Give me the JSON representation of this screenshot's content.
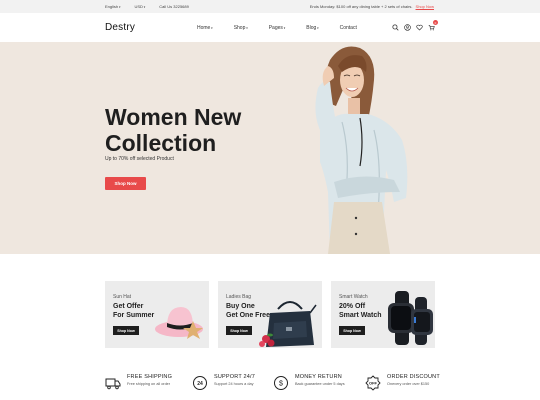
{
  "topbar": {
    "language": "English",
    "currency": "USD",
    "phone": "Call Us 3225689",
    "promo": "Ends Monday: $100 off any dining table + 2 sets of chairs.",
    "promo_link": "Shop Now"
  },
  "header": {
    "logo": "Destry",
    "nav": [
      "Home",
      "Shop",
      "Pages",
      "Blog",
      "Contact"
    ],
    "cart_count": "0",
    "icons": [
      "search-icon",
      "user-icon",
      "heart-icon",
      "cart-icon"
    ]
  },
  "hero": {
    "title_line1": "Women New",
    "title_line2": "Collection",
    "subtitle": "Up to 70% off selected Product",
    "button": "Shop Now"
  },
  "banners": [
    {
      "category": "Sun Hat",
      "title_line1": "Get Offer",
      "title_line2": "For Summer",
      "button": "Shop Now"
    },
    {
      "category": "Ladies Bag",
      "title_line1": "Buy One",
      "title_line2": "Get One Free",
      "button": "Shop Now"
    },
    {
      "category": "Smart Watch",
      "title_line1": "20% Off",
      "title_line2": "Smart Watch",
      "button": "Shop Now"
    }
  ],
  "features": [
    {
      "title": "FREE SHIPPING",
      "subtitle": "Free shipping on all order"
    },
    {
      "title": "SUPPORT 24/7",
      "subtitle": "Support 24 hours a day"
    },
    {
      "title": "MONEY RETURN",
      "subtitle": "Back guarantee under 5 days"
    },
    {
      "title": "ORDER DISCOUNT",
      "subtitle": "Onevery order over $150"
    }
  ],
  "colors": {
    "accent": "#e84a4a",
    "hero_bg": "#efe7df",
    "banner_bg": "#ececec",
    "dark": "#1e1e1e"
  }
}
